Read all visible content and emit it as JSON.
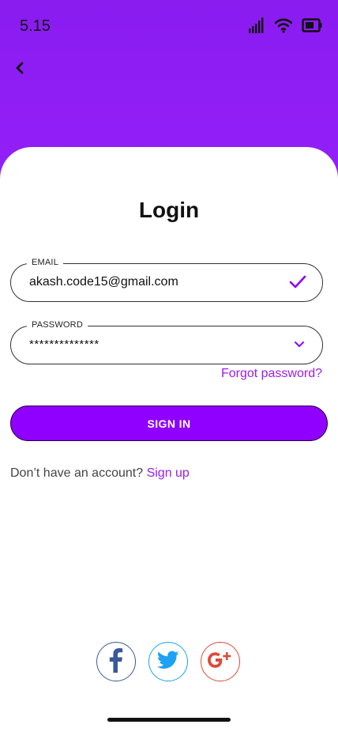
{
  "status_bar": {
    "time": "5.15"
  },
  "page": {
    "title": "Login"
  },
  "form": {
    "email": {
      "label": "EMAIL",
      "value": "akash.code15@gmail.com"
    },
    "password": {
      "label": "PASSWORD",
      "value": "**************"
    },
    "forgot_password": "Forgot password?",
    "sign_in_label": "SIGN IN"
  },
  "signup": {
    "prompt": "Don’t have an account? ",
    "link": "Sign up"
  },
  "icons": {
    "back": "chevron-left-icon",
    "email_valid": "checkmark-icon",
    "password_toggle": "chevron-down-icon",
    "social": [
      "facebook-icon",
      "twitter-icon",
      "google-plus-icon"
    ]
  },
  "colors": {
    "accent": "#8f00ff",
    "link": "#9b1cf0",
    "gradient_top": "#8a1cf0",
    "facebook": "#3b5998",
    "twitter": "#1da1f2",
    "google_plus": "#dd4b39"
  }
}
